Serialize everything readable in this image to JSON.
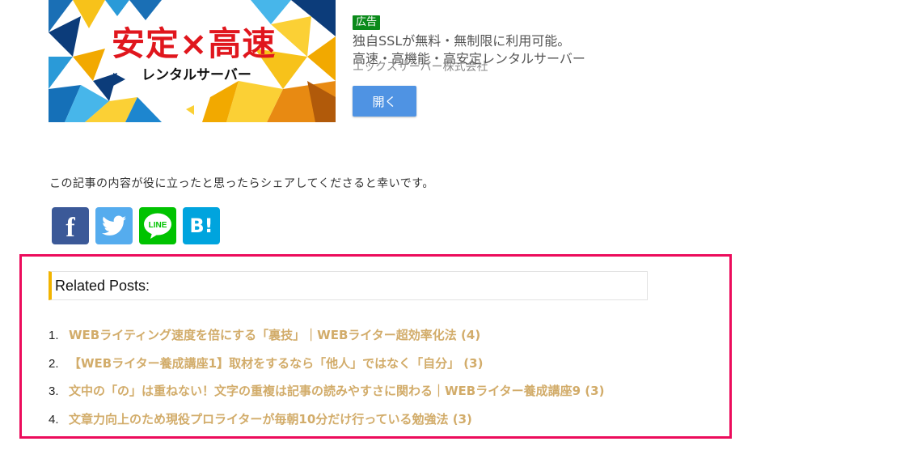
{
  "ad": {
    "banner_headline": "安定×高速",
    "banner_subline": "レンタルサーバー",
    "badge": "広告",
    "line1": "独自SSLが無料・無制限に利用可能。",
    "line2": "高速・高機能・高安定レンタルサーバー",
    "advertiser": "エックスサーバー株式会社",
    "open_button": "開く",
    "colors": {
      "badge": "#0a8a1a",
      "button": "#4f93e3",
      "headline": "#e0161d"
    }
  },
  "share": {
    "prompt": "この記事の内容が役に立ったと思ったらシェアしてくださると幸いです。",
    "buttons": [
      {
        "name": "facebook",
        "label": "f",
        "color": "#3b5998"
      },
      {
        "name": "twitter",
        "label": "",
        "color": "#55acee"
      },
      {
        "name": "line",
        "label": "LINE",
        "color": "#00c300"
      },
      {
        "name": "hatena",
        "label": "B!",
        "color": "#00a4de"
      }
    ]
  },
  "related": {
    "title": "Related Posts:",
    "items": [
      {
        "num": "1.",
        "title": "WEBライティング速度を倍にする「裏技」｜WEBライター超効率化法 (4)"
      },
      {
        "num": "2.",
        "title": "【WEBライター養成講座1】取材をするなら「他人」ではなく「自分」 (3)"
      },
      {
        "num": "3.",
        "title": "文中の「の」は重ねない！文字の重複は記事の読みやすさに関わる｜WEBライター養成講座9 (3)"
      },
      {
        "num": "4.",
        "title": "文章力向上のため現役プロライターが毎朝10分だけ行っている勉強法 (3)"
      }
    ],
    "colors": {
      "frame": "#ec0c5c",
      "accent": "#f2b400",
      "link": "#d2ac6a"
    }
  }
}
